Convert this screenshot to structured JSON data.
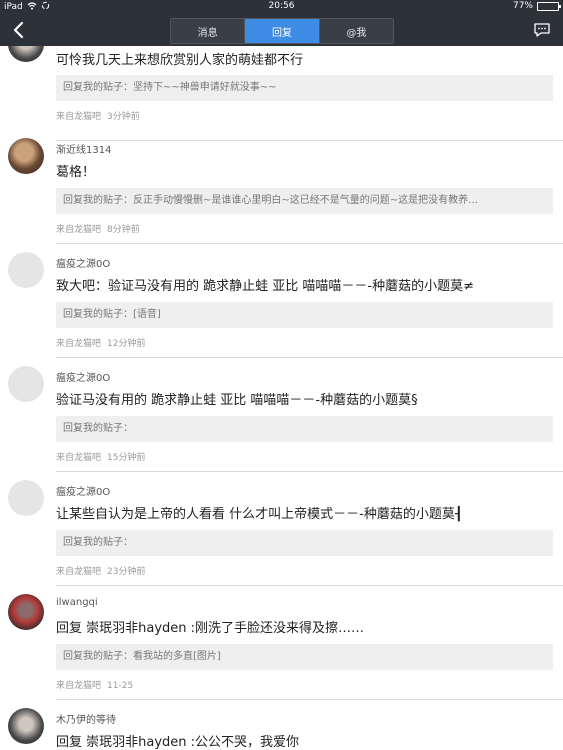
{
  "status_bar": {
    "device": "iPad",
    "time": "20:56",
    "battery": "77%",
    "battery_level": 0.77
  },
  "nav": {
    "tabs": [
      {
        "label": "消息",
        "active": false
      },
      {
        "label": "回复",
        "active": true
      },
      {
        "label": "@我",
        "active": false
      }
    ]
  },
  "colors": {
    "nav_bg": "#2d3138",
    "active_tab": "#3f8ce4",
    "quote_bg": "#efefef"
  },
  "items": [
    {
      "username": "",
      "avatar": "default-avatar",
      "content": "可怜我几天上来想欣赏别人家的萌娃都不行",
      "quote": "回复我的贴子：坚持下~~神兽申请好就没事~~",
      "source": "来自龙猫吧",
      "time": "3分钟前"
    },
    {
      "username": "渐近线1314",
      "avatar": "photo-avatar",
      "content": "葛格！",
      "quote": "回复我的贴子：反正手动慢慢删~是谁谁心里明白~这已经不是气量的问题~这是把没有教养…",
      "source": "来自龙猫吧",
      "time": "8分钟前"
    },
    {
      "username": "瘟疫之源0O",
      "avatar": "default-avatar",
      "content": "致大吧：验证马没有用的 跪求静止蛙 亚比 喵喵喵－－-种蘑菇的小题莫≠",
      "quote": "回复我的贴子：[语音]",
      "source": "来自龙猫吧",
      "time": "12分钟前"
    },
    {
      "username": "瘟疫之源0O",
      "avatar": "default-avatar",
      "content": "验证马没有用的 跪求静止蛙 亚比 喵喵喵－－-种蘑菇的小题莫§",
      "quote": "回复我的贴子：",
      "source": "来自龙猫吧",
      "time": "15分钟前"
    },
    {
      "username": "瘟疫之源0O",
      "avatar": "default-avatar",
      "content": "让某些自认为是上帝的人看看 什么才叫上帝模式－－-种蘑菇的小题莫┨",
      "quote": "回复我的贴子：",
      "source": "来自龙猫吧",
      "time": "23分钟前"
    },
    {
      "username": "ilwangqi",
      "avatar": "photo-avatar",
      "content": "回复 崇珉羽非hayden :刚洗了手脸还没来得及擦……",
      "quote": "回复我的贴子：看我站的多直[图片]",
      "source": "来自龙猫吧",
      "time": "11-25"
    },
    {
      "username": "木乃伊的等待",
      "avatar": "photo-avatar",
      "content": "回复 崇珉羽非hayden :公公不哭，我爱你",
      "quote": "",
      "source": "",
      "time": ""
    }
  ]
}
